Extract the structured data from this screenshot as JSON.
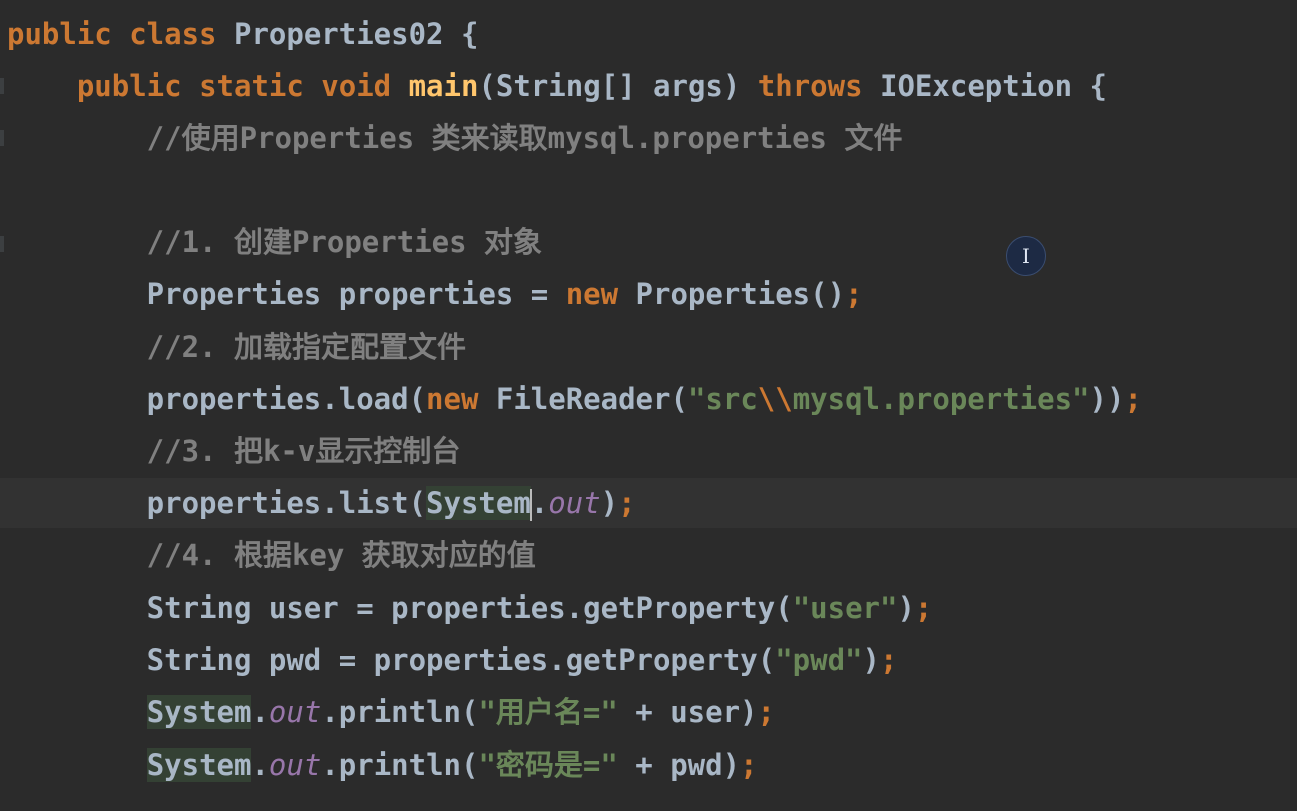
{
  "editor": {
    "lines": [
      {
        "tokens": [
          {
            "t": "public ",
            "c": "kw"
          },
          {
            "t": "class ",
            "c": "kw"
          },
          {
            "t": "Properties02 ",
            "c": "cls"
          },
          {
            "t": "{",
            "c": "cls"
          }
        ]
      },
      {
        "tokens": [
          {
            "t": "    public ",
            "c": "kw"
          },
          {
            "t": "static ",
            "c": "kw"
          },
          {
            "t": "void ",
            "c": "kw"
          },
          {
            "t": "main",
            "c": "fn"
          },
          {
            "t": "(String[] args) ",
            "c": "cls"
          },
          {
            "t": "throws ",
            "c": "kw"
          },
          {
            "t": "IOException {",
            "c": "cls"
          }
        ]
      },
      {
        "tokens": [
          {
            "t": "        //使用Properties 类来读取mysql.properties 文件",
            "c": "cm"
          }
        ]
      },
      {
        "tokens": []
      },
      {
        "tokens": [
          {
            "t": "        //1. 创建Properties 对象",
            "c": "cm"
          }
        ]
      },
      {
        "tokens": [
          {
            "t": "        Properties properties = ",
            "c": "cls"
          },
          {
            "t": "new ",
            "c": "kw"
          },
          {
            "t": "Properties()",
            "c": "cls"
          },
          {
            "t": ";",
            "c": "semi"
          }
        ]
      },
      {
        "tokens": [
          {
            "t": "        //2. 加载指定配置文件",
            "c": "cm"
          }
        ]
      },
      {
        "tokens": [
          {
            "t": "        properties.load(",
            "c": "cls"
          },
          {
            "t": "new ",
            "c": "kw"
          },
          {
            "t": "FileReader(",
            "c": "cls"
          },
          {
            "t": "\"src",
            "c": "str"
          },
          {
            "t": "\\\\",
            "c": "esc"
          },
          {
            "t": "mysql.properties\"",
            "c": "str"
          },
          {
            "t": "))",
            "c": "cls"
          },
          {
            "t": ";",
            "c": "semi"
          }
        ]
      },
      {
        "tokens": [
          {
            "t": "        //3. 把k-v显示控制台",
            "c": "cm"
          }
        ]
      },
      {
        "tokens": [
          {
            "t": "        properties.list(",
            "c": "cls"
          },
          {
            "t": "System",
            "c": "cls sys-bg"
          },
          {
            "t": "",
            "c": "caret"
          },
          {
            "t": ".",
            "c": "cls"
          },
          {
            "t": "out",
            "c": "fld"
          },
          {
            "t": ")",
            "c": "cls"
          },
          {
            "t": ";",
            "c": "semi"
          }
        ]
      },
      {
        "tokens": [
          {
            "t": "        //4. 根据key 获取对应的值",
            "c": "cm"
          }
        ]
      },
      {
        "tokens": [
          {
            "t": "        String user = properties.getProperty(",
            "c": "cls"
          },
          {
            "t": "\"user\"",
            "c": "str"
          },
          {
            "t": ")",
            "c": "cls"
          },
          {
            "t": ";",
            "c": "semi"
          }
        ]
      },
      {
        "tokens": [
          {
            "t": "        String pwd = properties.getProperty(",
            "c": "cls"
          },
          {
            "t": "\"pwd\"",
            "c": "str"
          },
          {
            "t": ")",
            "c": "cls"
          },
          {
            "t": ";",
            "c": "semi"
          }
        ]
      },
      {
        "tokens": [
          {
            "t": "        ",
            "c": "cls"
          },
          {
            "t": "System",
            "c": "cls sys-bg"
          },
          {
            "t": ".",
            "c": "cls"
          },
          {
            "t": "out",
            "c": "fld"
          },
          {
            "t": ".println(",
            "c": "cls"
          },
          {
            "t": "\"用户名=\"",
            "c": "str"
          },
          {
            "t": " + user)",
            "c": "cls"
          },
          {
            "t": ";",
            "c": "semi"
          }
        ]
      },
      {
        "tokens": [
          {
            "t": "        ",
            "c": "cls"
          },
          {
            "t": "System",
            "c": "cls sys-bg"
          },
          {
            "t": ".",
            "c": "cls"
          },
          {
            "t": "out",
            "c": "fld"
          },
          {
            "t": ".println(",
            "c": "cls"
          },
          {
            "t": "\"密码是=\"",
            "c": "str"
          },
          {
            "t": " + pwd)",
            "c": "cls"
          },
          {
            "t": ";",
            "c": "semi"
          }
        ]
      }
    ]
  },
  "cursor_badge": {
    "glyph": "I",
    "icon": "text-cursor-icon"
  },
  "colors": {
    "background": "#2b2b2b",
    "keyword": "#cc7832",
    "identifier": "#a9b7c6",
    "method": "#ffc66d",
    "comment": "#808080",
    "string": "#6a8759",
    "field": "#9876aa",
    "current_line": "#323232"
  }
}
